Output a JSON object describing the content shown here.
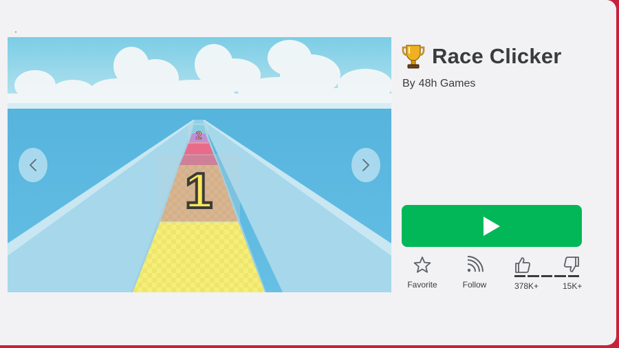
{
  "game": {
    "title": "Race Clicker",
    "creator_prefix": "By",
    "creator_name": "48h Games",
    "title_icon": "trophy-icon"
  },
  "carousel": {
    "prev_icon": "chevron-left-icon",
    "next_icon": "chevron-right-icon",
    "track_marker_near": "1",
    "track_marker_far": "2"
  },
  "play": {
    "icon": "play-icon"
  },
  "actions": {
    "favorite_label": "Favorite",
    "favorite_icon": "star-icon",
    "follow_label": "Follow",
    "follow_icon": "rss-icon"
  },
  "votes": {
    "up_icon": "thumbs-up-icon",
    "down_icon": "thumbs-down-icon",
    "up_count": "378K+",
    "down_count": "15K+"
  },
  "colors": {
    "play_green": "#02b757",
    "text": "#393b3d",
    "page_bg": "#f2f2f4",
    "outer_border": "#c7213b"
  }
}
